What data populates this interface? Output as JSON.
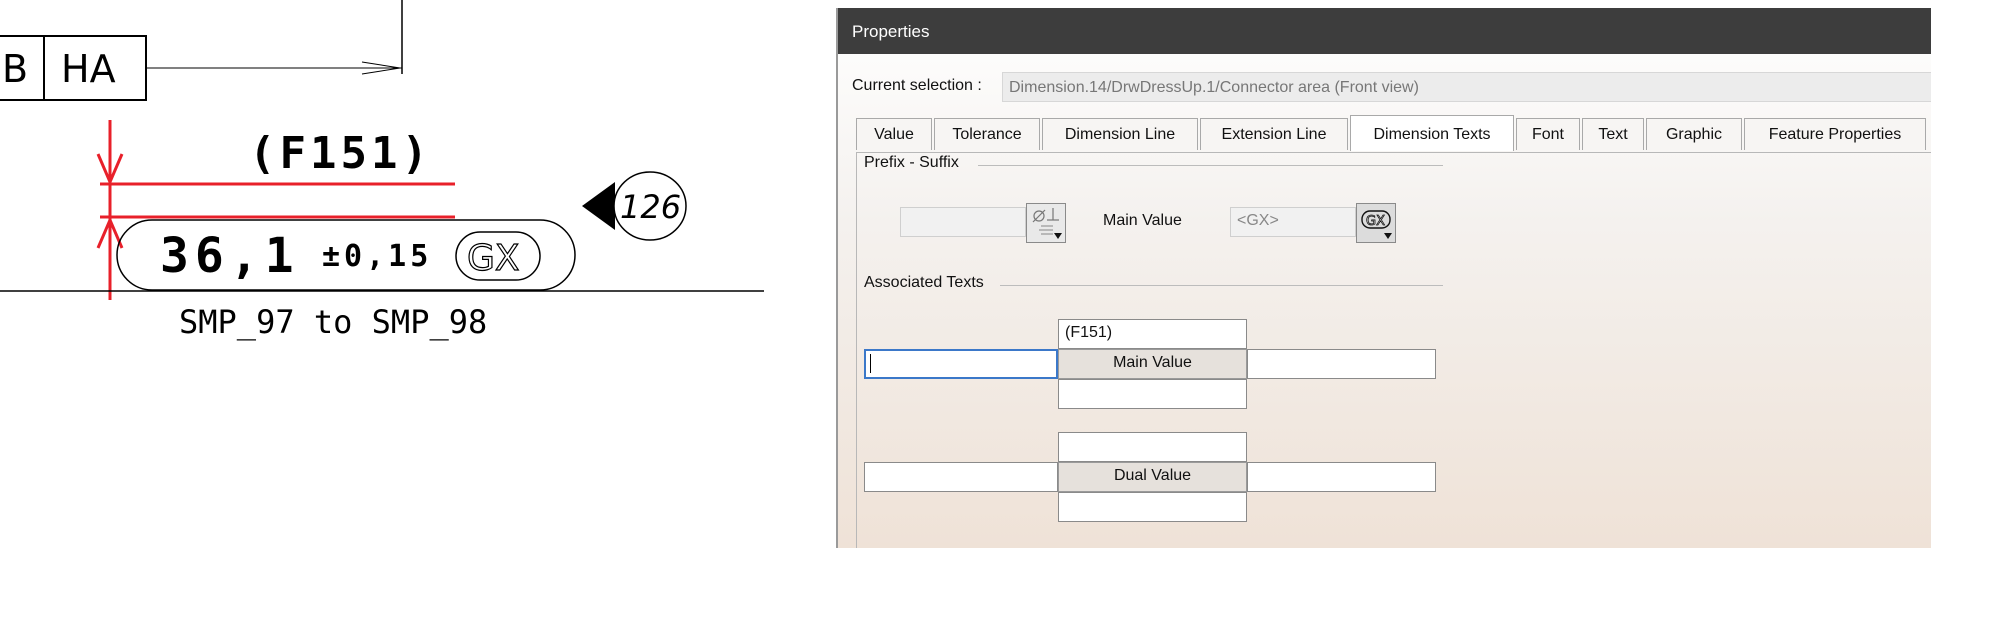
{
  "drawing": {
    "frame_cells": [
      "B",
      "HA"
    ],
    "reference_text": "(F151)",
    "dimension_value": "36,1",
    "tolerance": "±0,15",
    "gx_symbol": "GX",
    "balloon_number": "126",
    "caption": "SMP_97 to SMP_98",
    "markup_color": "#e8202a"
  },
  "dialog": {
    "title": "Properties",
    "current_selection_label": "Current selection :",
    "current_selection_value": "Dimension.14/DrwDressUp.1/Connector area (Front view)",
    "tabs": [
      {
        "label": "Value"
      },
      {
        "label": "Tolerance"
      },
      {
        "label": "Dimension Line"
      },
      {
        "label": "Extension Line"
      },
      {
        "label": "Dimension Texts",
        "active": true
      },
      {
        "label": "Font"
      },
      {
        "label": "Text"
      },
      {
        "label": "Graphic"
      },
      {
        "label": "Feature Properties"
      }
    ],
    "prefix_suffix": {
      "group_label": "Prefix - Suffix",
      "prefix_value": "",
      "prefix_symbol_icon": "angle-perpendicular-symbol-icon",
      "main_value_label": "Main Value",
      "main_value_field": "<GX>",
      "gx_symbol_icon": "gx-symbol-icon",
      "gx_symbol_text": "GX"
    },
    "associated_texts": {
      "group_label": "Associated Texts",
      "main": {
        "label": "Main Value",
        "above": "(F151)",
        "below": "",
        "before": "",
        "after": ""
      },
      "dual": {
        "label": "Dual Value",
        "above": "",
        "below": "",
        "before": "",
        "after": ""
      }
    }
  }
}
